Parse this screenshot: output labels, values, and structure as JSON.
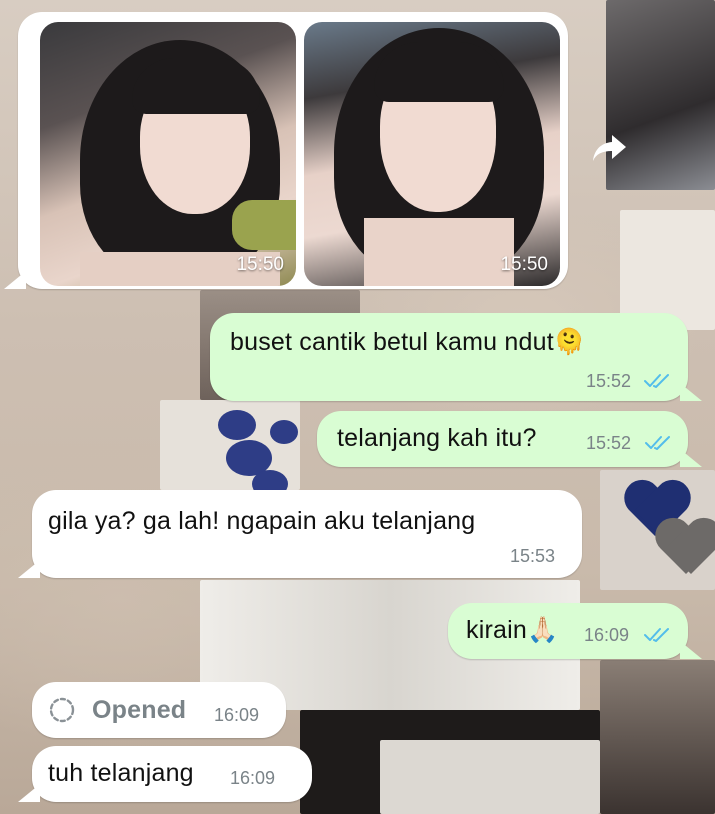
{
  "chat": {
    "photos": [
      {
        "time": "15:50",
        "icon": "photo-thumbnail"
      },
      {
        "time": "15:50",
        "icon": "photo-thumbnail"
      }
    ],
    "messages": [
      {
        "direction": "out",
        "text": "buset cantik betul kamu ndut🫠",
        "time": "15:52",
        "status": "read"
      },
      {
        "direction": "out",
        "text": "telanjang kah itu?",
        "time": "15:52",
        "status": "read"
      },
      {
        "direction": "in",
        "text": "gila ya? ga lah! ngapain aku telanjang",
        "time": "15:53"
      },
      {
        "direction": "out",
        "text": "kirain🙏🏻",
        "time": "16:09",
        "status": "read"
      },
      {
        "direction": "in",
        "text": "Opened",
        "time": "16:09",
        "kind": "view-once-opened"
      },
      {
        "direction": "in",
        "text": "tuh telanjang",
        "time": "16:09"
      }
    ]
  },
  "icons": {
    "forward": "forward-icon",
    "read_receipt": "double-check-icon",
    "opened": "view-once-opened-icon"
  },
  "colors": {
    "outgoing_bubble": "#d9fdd3",
    "incoming_bubble": "#ffffff",
    "read_tick": "#53bdeb",
    "timestamp": "#7a8388"
  }
}
